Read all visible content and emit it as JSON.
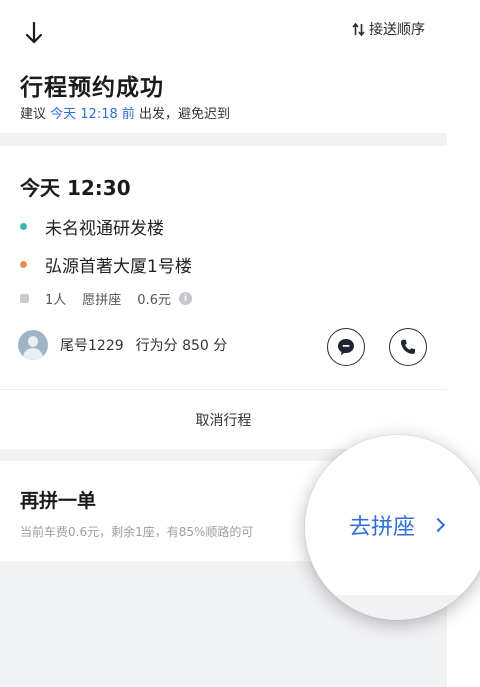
{
  "header": {
    "order_label": "接送顺序",
    "title": "行程预约成功",
    "subtitle_prefix": "建议 ",
    "subtitle_highlight": "今天 12:18 前",
    "subtitle_suffix": " 出发，避免迟到"
  },
  "trip": {
    "time": "今天 12:30",
    "from": "未名视通研发楼",
    "to": "弘源首著大厦1号楼",
    "passengers": "1人",
    "seat_type": "愿拼座",
    "price": "0.6元",
    "driver_plate": "尾号1229",
    "driver_score": "行为分 850 分",
    "cancel_label": "取消行程"
  },
  "carpool": {
    "title": "再拼一单",
    "desc": "当前车费0.6元，剩余1座，有85%顺路的可",
    "go_label": "去拼座"
  },
  "colors": {
    "accent": "#2f6fd6",
    "origin_dot": "#3bb8a8",
    "destination_dot": "#f08a4b"
  },
  "icons": {
    "back": "arrow-down-icon",
    "sort": "sort-icon",
    "info": "info-icon",
    "message": "message-icon",
    "phone": "phone-icon",
    "chevron": "chevron-right-icon"
  }
}
